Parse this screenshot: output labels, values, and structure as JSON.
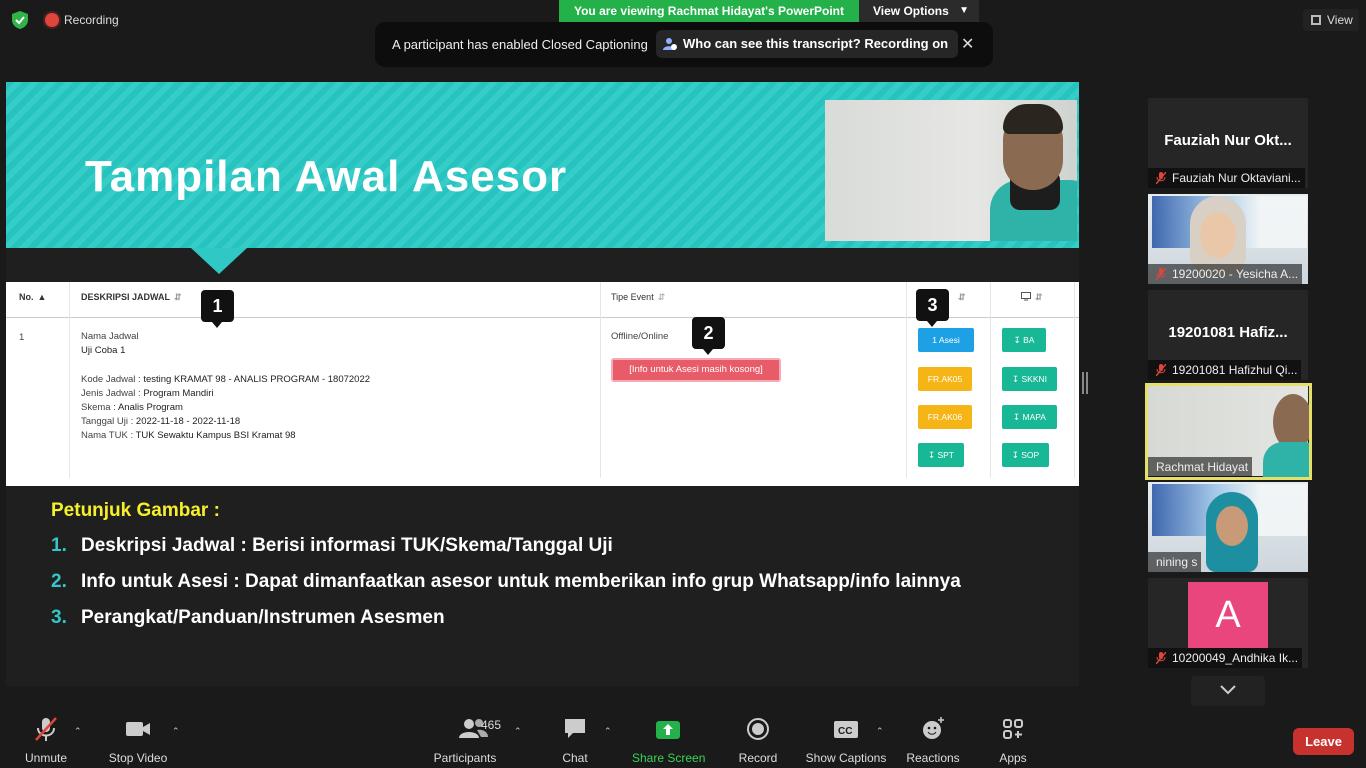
{
  "topbar": {
    "recording_label": "Recording",
    "viewing_label": "You are viewing Rachmat Hidayat's PowerPoint",
    "view_options_label": "View Options",
    "view_label": "View"
  },
  "caption_notice": {
    "message": "A participant has enabled Closed Captioning",
    "who_can_see": "Who can see this transcript? Recording on"
  },
  "slide": {
    "title": "Tampilan Awal Asesor",
    "table": {
      "headers": {
        "no": "No.",
        "deskripsi": "DESKRIPSI JADWAL",
        "tipe": "Tipe Event"
      },
      "row": {
        "no": "1",
        "nama_jadwal_label": "Nama Jadwal",
        "nama_jadwal_value": "Uji Coba 1",
        "kode_label": "Kode Jadwal : ",
        "kode_value": "testing KRAMAT 98 - ANALIS PROGRAM - 18072022",
        "jenis_label": "Jenis Jadwal : ",
        "jenis_value": "Program Mandiri",
        "skema_label": "Skema : ",
        "skema_value": "Analis Program",
        "tanggal_label": "Tanggal Uji : ",
        "tanggal_value": "2022-11-18 - 2022-11-18",
        "tuk_label": "Nama TUK : ",
        "tuk_value": "TUK Sewaktu Kampus BSI Kramat 98",
        "tipe_event": "Offline/Online",
        "info_badge": "[Info untuk Asesi masih kosong]"
      },
      "buttons_col3": [
        "1 Asesi",
        "FR.AK05",
        "FR.AK06",
        "SPT"
      ],
      "buttons_col4": [
        "BA",
        "SKKNI",
        "MAPA",
        "SOP"
      ],
      "markers": [
        "1",
        "2",
        "3"
      ]
    },
    "petunjuk_title": "Petunjuk Gambar :",
    "instructions": [
      {
        "num": "1.",
        "text": "Deskripsi Jadwal : Berisi informasi TUK/Skema/Tanggal Uji"
      },
      {
        "num": "2.",
        "text": "Info untuk Asesi : Dapat dimanfaatkan asesor untuk memberikan info grup Whatsapp/info lainnya"
      },
      {
        "num": "3.",
        "text": "Perangkat/Panduan/Instrumen Asesmen"
      }
    ]
  },
  "gallery": [
    {
      "big_name": "Fauziah Nur Okt...",
      "caption": "Fauziah Nur Oktaviani...",
      "muted": true,
      "video": false
    },
    {
      "big_name": "",
      "caption": "19200020 - Yesicha A...",
      "muted": true,
      "video": true
    },
    {
      "big_name": "19201081 Hafiz...",
      "caption": "19201081 Hafizhul Qi...",
      "muted": true,
      "video": false
    },
    {
      "big_name": "",
      "caption": "Rachmat Hidayat",
      "muted": false,
      "video": true
    },
    {
      "big_name": "",
      "caption": "nining s",
      "muted": false,
      "video": true
    },
    {
      "big_name": "A",
      "caption": "10200049_Andhika Ik...",
      "muted": true,
      "video": false
    }
  ],
  "toolbar": {
    "unmute": "Unmute",
    "stop_video": "Stop Video",
    "participants_count": "465",
    "participants": "Participants",
    "chat": "Chat",
    "share_screen": "Share Screen",
    "record": "Record",
    "show_captions": "Show Captions",
    "reactions": "Reactions",
    "apps": "Apps",
    "leave": "Leave"
  },
  "colors": {
    "banner_teal": "#27c3bf",
    "share_green": "#25b14a",
    "leave_red": "#c7322f",
    "petunjuk_yellow": "#f6f02a"
  }
}
